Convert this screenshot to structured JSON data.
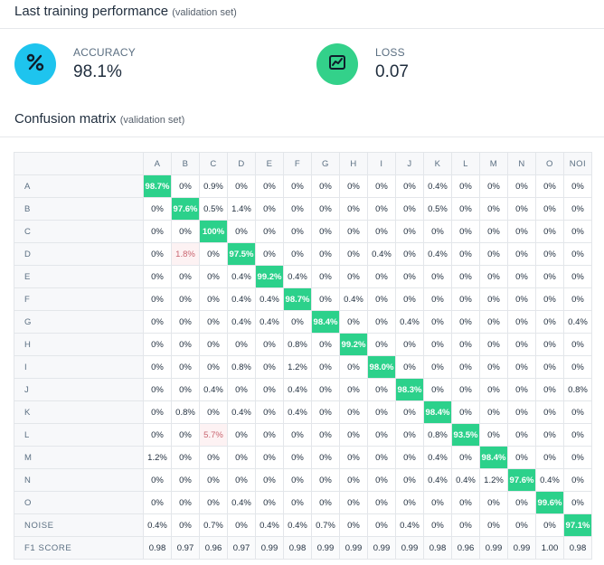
{
  "header": {
    "title": "Last training performance",
    "subtitle": "(validation set)"
  },
  "metrics": [
    {
      "label": "ACCURACY",
      "value": "98.1%",
      "icon": "percent-icon",
      "color": "#1ec4ee"
    },
    {
      "label": "LOSS",
      "value": "0.07",
      "icon": "line-chart-icon",
      "color": "#33d18a"
    }
  ],
  "confusion": {
    "title": "Confusion matrix",
    "subtitle": "(validation set)",
    "columns": [
      "A",
      "B",
      "C",
      "D",
      "E",
      "F",
      "G",
      "H",
      "I",
      "J",
      "K",
      "L",
      "M",
      "N",
      "O",
      "NOI"
    ],
    "rows": [
      {
        "label": "A",
        "cells": [
          "98.7%",
          "0%",
          "0.9%",
          "0%",
          "0%",
          "0%",
          "0%",
          "0%",
          "0%",
          "0%",
          "0.4%",
          "0%",
          "0%",
          "0%",
          "0%",
          "0%"
        ]
      },
      {
        "label": "B",
        "cells": [
          "0%",
          "97.6%",
          "0.5%",
          "1.4%",
          "0%",
          "0%",
          "0%",
          "0%",
          "0%",
          "0%",
          "0.5%",
          "0%",
          "0%",
          "0%",
          "0%",
          "0%"
        ]
      },
      {
        "label": "C",
        "cells": [
          "0%",
          "0%",
          "100%",
          "0%",
          "0%",
          "0%",
          "0%",
          "0%",
          "0%",
          "0%",
          "0%",
          "0%",
          "0%",
          "0%",
          "0%",
          "0%"
        ]
      },
      {
        "label": "D",
        "cells": [
          "0%",
          "1.8%",
          "0%",
          "97.5%",
          "0%",
          "0%",
          "0%",
          "0%",
          "0.4%",
          "0%",
          "0.4%",
          "0%",
          "0%",
          "0%",
          "0%",
          "0%"
        ]
      },
      {
        "label": "E",
        "cells": [
          "0%",
          "0%",
          "0%",
          "0.4%",
          "99.2%",
          "0.4%",
          "0%",
          "0%",
          "0%",
          "0%",
          "0%",
          "0%",
          "0%",
          "0%",
          "0%",
          "0%"
        ]
      },
      {
        "label": "F",
        "cells": [
          "0%",
          "0%",
          "0%",
          "0.4%",
          "0.4%",
          "98.7%",
          "0%",
          "0.4%",
          "0%",
          "0%",
          "0%",
          "0%",
          "0%",
          "0%",
          "0%",
          "0%"
        ]
      },
      {
        "label": "G",
        "cells": [
          "0%",
          "0%",
          "0%",
          "0.4%",
          "0.4%",
          "0%",
          "98.4%",
          "0%",
          "0%",
          "0.4%",
          "0%",
          "0%",
          "0%",
          "0%",
          "0%",
          "0.4%"
        ]
      },
      {
        "label": "H",
        "cells": [
          "0%",
          "0%",
          "0%",
          "0%",
          "0%",
          "0.8%",
          "0%",
          "99.2%",
          "0%",
          "0%",
          "0%",
          "0%",
          "0%",
          "0%",
          "0%",
          "0%"
        ]
      },
      {
        "label": "I",
        "cells": [
          "0%",
          "0%",
          "0%",
          "0.8%",
          "0%",
          "1.2%",
          "0%",
          "0%",
          "98.0%",
          "0%",
          "0%",
          "0%",
          "0%",
          "0%",
          "0%",
          "0%"
        ]
      },
      {
        "label": "J",
        "cells": [
          "0%",
          "0%",
          "0.4%",
          "0%",
          "0%",
          "0.4%",
          "0%",
          "0%",
          "0%",
          "98.3%",
          "0%",
          "0%",
          "0%",
          "0%",
          "0%",
          "0.8%"
        ]
      },
      {
        "label": "K",
        "cells": [
          "0%",
          "0.8%",
          "0%",
          "0.4%",
          "0%",
          "0.4%",
          "0%",
          "0%",
          "0%",
          "0%",
          "98.4%",
          "0%",
          "0%",
          "0%",
          "0%",
          "0%"
        ]
      },
      {
        "label": "L",
        "cells": [
          "0%",
          "0%",
          "5.7%",
          "0%",
          "0%",
          "0%",
          "0%",
          "0%",
          "0%",
          "0%",
          "0.8%",
          "93.5%",
          "0%",
          "0%",
          "0%",
          "0%"
        ]
      },
      {
        "label": "M",
        "cells": [
          "1.2%",
          "0%",
          "0%",
          "0%",
          "0%",
          "0%",
          "0%",
          "0%",
          "0%",
          "0%",
          "0.4%",
          "0%",
          "98.4%",
          "0%",
          "0%",
          "0%"
        ]
      },
      {
        "label": "N",
        "cells": [
          "0%",
          "0%",
          "0%",
          "0%",
          "0%",
          "0%",
          "0%",
          "0%",
          "0%",
          "0%",
          "0.4%",
          "0.4%",
          "1.2%",
          "97.6%",
          "0.4%",
          "0%"
        ]
      },
      {
        "label": "O",
        "cells": [
          "0%",
          "0%",
          "0%",
          "0.4%",
          "0%",
          "0%",
          "0%",
          "0%",
          "0%",
          "0%",
          "0%",
          "0%",
          "0%",
          "0%",
          "99.6%",
          "0%"
        ]
      },
      {
        "label": "NOISE",
        "cells": [
          "0.4%",
          "0%",
          "0.7%",
          "0%",
          "0.4%",
          "0.4%",
          "0.7%",
          "0%",
          "0%",
          "0.4%",
          "0%",
          "0%",
          "0%",
          "0%",
          "0%",
          "97.1%"
        ]
      }
    ],
    "f1": {
      "label": "F1 SCORE",
      "cells": [
        "0.98",
        "0.97",
        "0.96",
        "0.97",
        "0.99",
        "0.98",
        "0.99",
        "0.99",
        "0.99",
        "0.99",
        "0.98",
        "0.96",
        "0.99",
        "0.99",
        "1.00",
        "0.98"
      ]
    },
    "highlighted_errors": [
      {
        "row": 3,
        "col": 1
      },
      {
        "row": 11,
        "col": 2
      }
    ],
    "colors": {
      "diagonal": "#2cd18b",
      "error_tint": "#fdf2f3",
      "error_text": "#c96570"
    }
  }
}
